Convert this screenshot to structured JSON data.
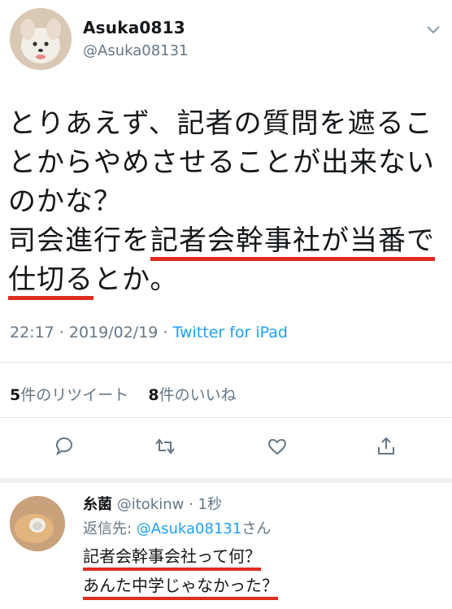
{
  "tweet": {
    "display_name": "Asuka0813",
    "handle": "@Asuka08131",
    "lines": [
      {
        "parts": [
          {
            "text": "とりあえず、記者の質問を遮るこ",
            "underline": false
          }
        ]
      },
      {
        "parts": [
          {
            "text": "とからやめさせることが出来ない",
            "underline": false
          }
        ]
      },
      {
        "parts": [
          {
            "text": "のかな？",
            "underline": false
          }
        ]
      },
      {
        "parts": [
          {
            "text": "司会進行を",
            "underline": false
          },
          {
            "text": "記者会幹事社が当番で",
            "underline": true
          }
        ]
      },
      {
        "parts": [
          {
            "text": "仕切る",
            "underline": true
          },
          {
            "text": "とか。",
            "underline": false
          }
        ]
      }
    ],
    "time": "22:17 · 2019/02/19 · ",
    "source": "Twitter for iPad",
    "retweet_count": "5",
    "retweet_label": "件のリツイート",
    "like_count": "8",
    "like_label": "件のいいね",
    "actions": [
      "reply-icon",
      "retweet-icon",
      "like-icon",
      "share-icon"
    ]
  },
  "reply": {
    "display_name": "糸菌",
    "handle_time": " @itokinw · 1秒",
    "reply_to_prefix": "返信先: ",
    "reply_to_mention": "@Asuka08131",
    "reply_to_suffix": "さん",
    "lines": [
      "記者会幹事会社って何？",
      "あんた中学じゃなかった？"
    ]
  },
  "colors": {
    "accent": "#1da1f2",
    "underline": "#e02b1f",
    "muted": "#657786"
  }
}
